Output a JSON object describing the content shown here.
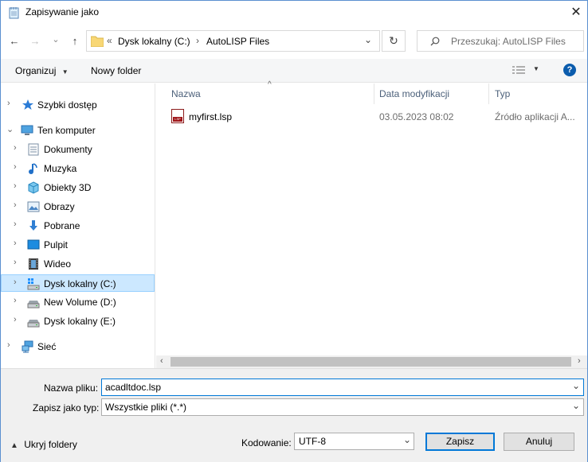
{
  "window": {
    "title": "Zapisywanie jako",
    "close_glyph": "✕",
    "title_icon": "notepad-icon"
  },
  "nav": {
    "back_glyph": "←",
    "forward_glyph": "→",
    "recent_glyph": "⌄",
    "up_glyph": "↑",
    "overflow_glyph": "«",
    "breadcrumb": [
      "Dysk lokalny (C:)",
      "AutoLISP Files"
    ],
    "crumb_sep": "›",
    "dropdown_glyph": "⌄",
    "refresh_glyph": "↻",
    "search_placeholder": "Przeszukaj: AutoLISP Files"
  },
  "toolbar": {
    "organize_label": "Organizuj",
    "new_folder_label": "Nowy folder",
    "help_glyph": "?"
  },
  "tree": {
    "items": [
      {
        "label": "Szybki dostęp",
        "icon": "star-icon",
        "level": 0,
        "expanded": false
      },
      {
        "label": "Ten komputer",
        "icon": "computer-icon",
        "level": 0,
        "expanded": true
      },
      {
        "label": "Dokumenty",
        "icon": "documents-icon",
        "level": 1
      },
      {
        "label": "Muzyka",
        "icon": "music-icon",
        "level": 1
      },
      {
        "label": "Obiekty 3D",
        "icon": "cube-icon",
        "level": 1
      },
      {
        "label": "Obrazy",
        "icon": "pictures-icon",
        "level": 1
      },
      {
        "label": "Pobrane",
        "icon": "download-icon",
        "level": 1
      },
      {
        "label": "Pulpit",
        "icon": "desktop-icon",
        "level": 1
      },
      {
        "label": "Wideo",
        "icon": "video-icon",
        "level": 1
      },
      {
        "label": "Dysk lokalny (C:)",
        "icon": "windows-drive-icon",
        "level": 1,
        "selected": true
      },
      {
        "label": "New Volume (D:)",
        "icon": "drive-icon",
        "level": 1
      },
      {
        "label": "Dysk lokalny (E:)",
        "icon": "drive-icon",
        "level": 1
      },
      {
        "label": "Sieć",
        "icon": "network-icon",
        "level": 0
      }
    ]
  },
  "file_list": {
    "columns": [
      "Nazwa",
      "Data modyfikacji",
      "Typ"
    ],
    "sort_glyph": "^",
    "rows": [
      {
        "name": "myfirst.lsp",
        "modified": "03.05.2023 08:02",
        "type": "Źródło aplikacji A...",
        "icon_text": "LSP"
      }
    ]
  },
  "form": {
    "filename_label": "Nazwa pliku:",
    "filename_value": "acadltdoc.lsp",
    "filetype_label": "Zapisz jako typ:",
    "filetype_value": "Wszystkie pliki  (*.*)",
    "hide_folders_label": "Ukryj foldery",
    "encoding_label": "Kodowanie:",
    "encoding_value": "UTF-8",
    "save_label": "Zapisz",
    "cancel_label": "Anuluj"
  },
  "colors": {
    "accent": "#0078d7",
    "selection": "#cce8ff",
    "folder": "#f8d775"
  }
}
